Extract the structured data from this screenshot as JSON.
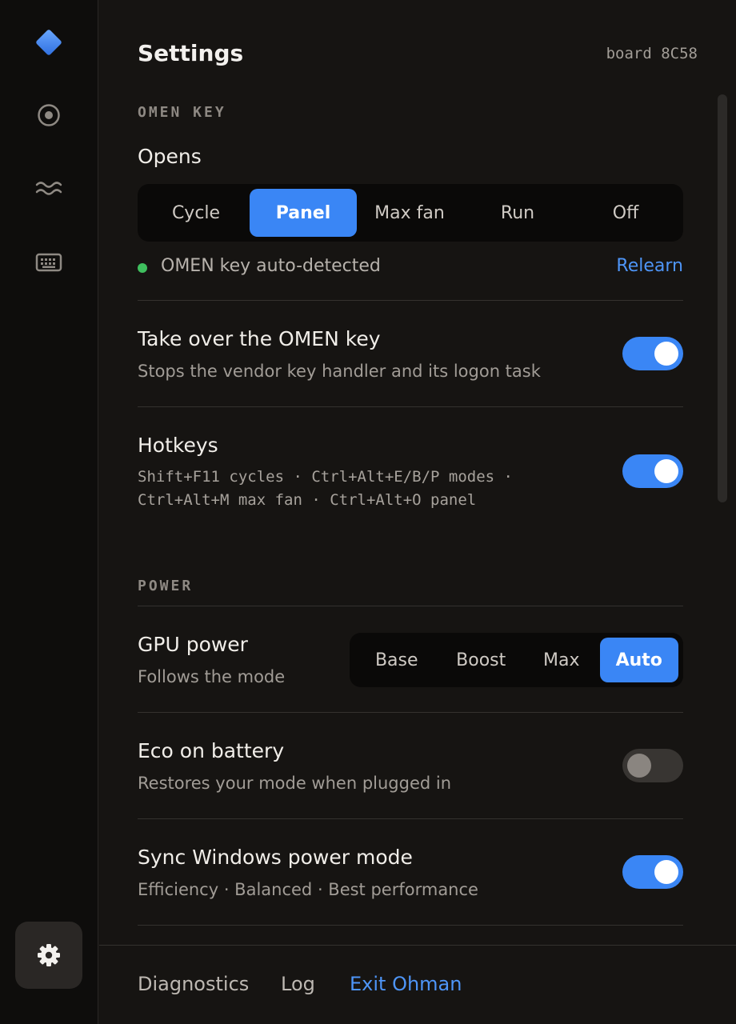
{
  "sidebar": {
    "items": [
      {
        "icon": "logo-diamond-icon"
      },
      {
        "icon": "target-icon"
      },
      {
        "icon": "waves-icon"
      },
      {
        "icon": "keyboard-icon"
      }
    ],
    "settings_icon": "gear-icon"
  },
  "header": {
    "title": "Settings",
    "board": "board 8C58"
  },
  "omen_key": {
    "section_label": "OMEN KEY",
    "opens_label": "Opens",
    "options": [
      "Cycle",
      "Panel",
      "Max fan",
      "Run",
      "Off"
    ],
    "selected": "Panel",
    "status": "OMEN key auto-detected",
    "relearn": "Relearn",
    "takeover": {
      "title": "Take over the OMEN key",
      "subtitle": "Stops the vendor key handler and its logon task",
      "on": true
    },
    "hotkeys": {
      "title": "Hotkeys",
      "line1": "Shift+F11 cycles · Ctrl+Alt+E/B/P modes ·",
      "line2": "Ctrl+Alt+M max fan · Ctrl+Alt+O panel",
      "on": true
    }
  },
  "power": {
    "section_label": "POWER",
    "gpu": {
      "title": "GPU power",
      "subtitle": "Follows the mode",
      "options": [
        "Base",
        "Boost",
        "Max",
        "Auto"
      ],
      "selected": "Auto"
    },
    "eco": {
      "title": "Eco on battery",
      "subtitle": "Restores your mode when plugged in",
      "on": false
    },
    "sync": {
      "title": "Sync Windows power mode",
      "subtitle": "Efficiency · Balanced · Best performance",
      "on": true
    }
  },
  "footer": {
    "diagnostics": "Diagnostics",
    "log": "Log",
    "exit": "Exit Ohman"
  },
  "colors": {
    "accent": "#3a86f5",
    "status_ok": "#3fbf5e",
    "background": "#161412",
    "sidebar": "#0e0d0c"
  }
}
